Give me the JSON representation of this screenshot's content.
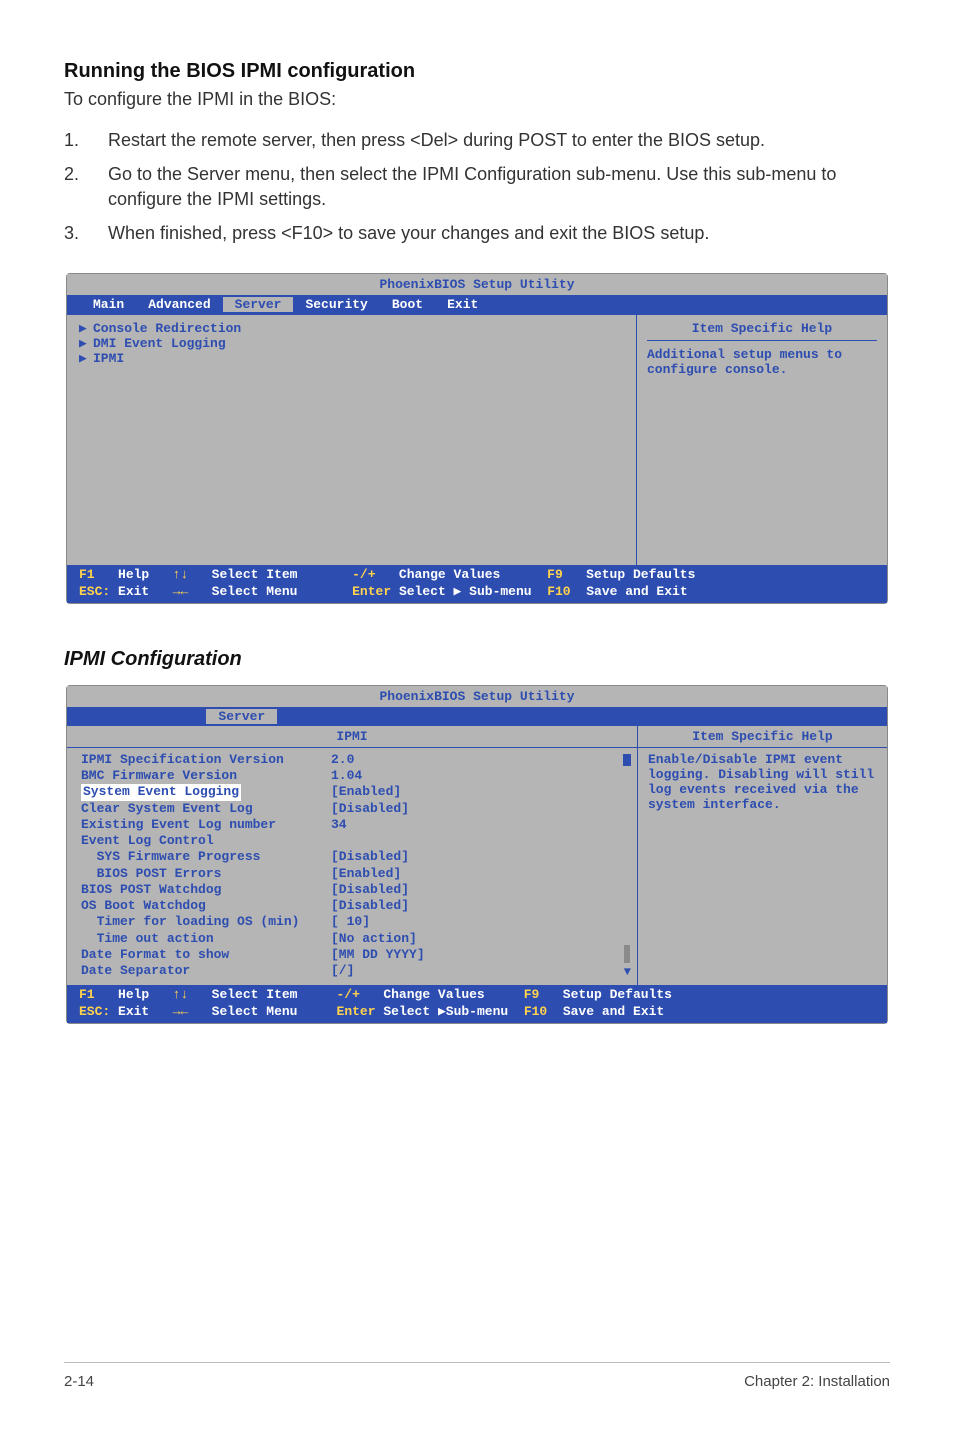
{
  "page": {
    "section1_heading": "Running the BIOS IPMI configuration",
    "intro": "To configure the IPMI in the BIOS:",
    "steps": [
      "Restart the remote server, then press <Del> during POST to enter the BIOS setup.",
      "Go to the Server menu, then select the IPMI Configuration sub-menu. Use this sub-menu to configure the IPMI settings.",
      "When finished, press <F10> to save your changes and exit the BIOS setup."
    ],
    "section2_heading": "IPMI Configuration",
    "footer_left": "2-14",
    "footer_right": "Chapter 2: Installation"
  },
  "bios1": {
    "title": "PhoenixBIOS Setup Utility",
    "tabs": [
      "Main",
      "Advanced",
      "Server",
      "Security",
      "Boot",
      "Exit"
    ],
    "active_tab": "Server",
    "menu_items": [
      "Console Redirection",
      "DMI Event Logging",
      "IPMI"
    ],
    "help_title": "Item Specific Help",
    "help_body": "Additional setup menus to configure console.",
    "footer": {
      "f1": "F1",
      "f1_label": "Help",
      "esc": "ESC:",
      "esc_label": "Exit",
      "updn": "↑↓",
      "updn_label": "Select Item",
      "lr": "→←",
      "lr_label": "Select Menu",
      "minus": "-/+",
      "minus_label": "Change Values",
      "enter": "Enter",
      "enter_label": "Select ▶ Sub-menu",
      "f9": "F9",
      "f9_label": "Setup Defaults",
      "f10": "F10",
      "f10_label": "Save and Exit"
    }
  },
  "bios2": {
    "title": "PhoenixBIOS Setup Utility",
    "active_tab": "Server",
    "submenu_title": "IPMI",
    "help_title": "Item Specific Help",
    "help_body": "Enable/Disable IPMI event logging. Disabling will still log events received via the system interface.",
    "items": [
      {
        "name": "IPMI Specification Version",
        "value": "2.0"
      },
      {
        "name": "BMC Firmware Version",
        "value": "1.04"
      },
      {
        "name": "System Event Logging",
        "value": "[Enabled]",
        "highlight": true
      },
      {
        "name": "Clear System Event Log",
        "value": "[Disabled]"
      },
      {
        "name": "Existing Event Log number",
        "value": "34"
      },
      {
        "name": "Event Log Control",
        "value": ""
      },
      {
        "name": "  SYS Firmware Progress",
        "value": "[Disabled]"
      },
      {
        "name": "  BIOS POST Errors",
        "value": "[Enabled]"
      },
      {
        "name": "BIOS POST Watchdog",
        "value": "[Disabled]"
      },
      {
        "name": "OS Boot Watchdog",
        "value": "[Disabled]"
      },
      {
        "name": "  Timer for loading OS (min)",
        "value": "[ 10]"
      },
      {
        "name": "  Time out action",
        "value": "[No action]"
      },
      {
        "name": "Date Format to show",
        "value": "[MM DD YYYY]"
      },
      {
        "name": "Date Separator",
        "value": "[/]"
      }
    ],
    "footer": {
      "f1": "F1",
      "f1_label": "Help",
      "esc": "ESC:",
      "esc_label": "Exit",
      "updn": "↑↓",
      "updn_label": "Select Item",
      "lr": "→←",
      "lr_label": "Select Menu",
      "minus": "-/+",
      "minus_label": "Change Values",
      "enter": "Enter",
      "enter_label": "Select ▶Sub-menu",
      "f9": "F9",
      "f9_label": "Setup Defaults",
      "f10": "F10",
      "f10_label": "Save and Exit"
    }
  }
}
